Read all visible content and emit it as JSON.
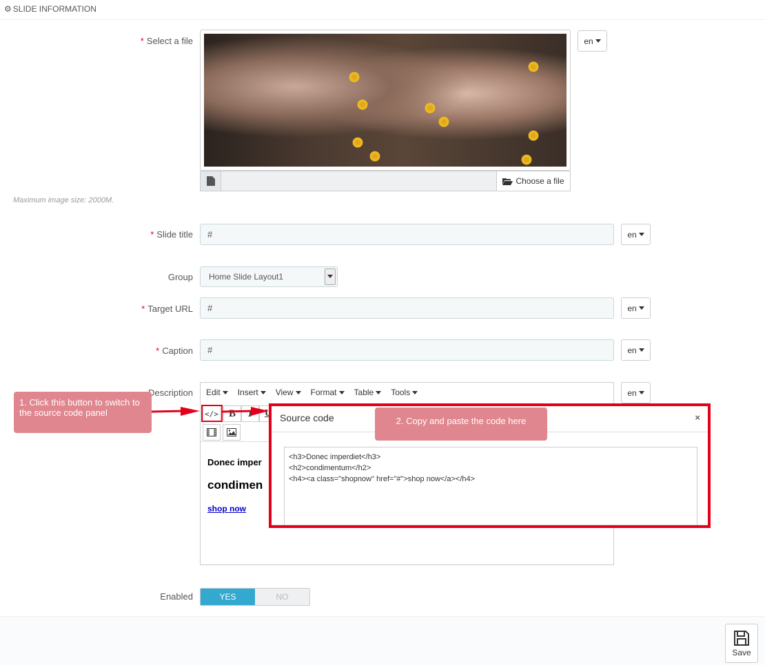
{
  "panel": {
    "title": "SLIDE INFORMATION",
    "icon": "gears-icon"
  },
  "fields": {
    "file": {
      "label": "Select a file",
      "lang": "en",
      "choose_label": "Choose a file",
      "help": "Maximum image size: 2000M."
    },
    "title": {
      "label": "Slide title",
      "value": "#",
      "lang": "en"
    },
    "group": {
      "label": "Group",
      "value": "Home Slide Layout1"
    },
    "url": {
      "label": "Target URL",
      "value": "#",
      "lang": "en"
    },
    "caption": {
      "label": "Caption",
      "value": "#",
      "lang": "en"
    },
    "description": {
      "label": "Description",
      "lang": "en"
    },
    "enabled": {
      "label": "Enabled",
      "yes": "YES",
      "no": "NO"
    }
  },
  "editor": {
    "menu": [
      "Edit",
      "Insert",
      "View",
      "Format",
      "Table",
      "Tools"
    ],
    "content": {
      "h3": "Donec imper",
      "h2": "condimen",
      "link": "shop now"
    }
  },
  "modal": {
    "title": "Source code",
    "close": "×",
    "code": "<h3>Donec imperdiet</h3>\n<h2>condimentum</h2>\n<h4><a class=\"shopnow\" href=\"#\">shop now</a></h4>"
  },
  "callouts": {
    "one": "1. Click this button to switch to the source code panel",
    "two": "2. Copy and paste the code here"
  },
  "footer": {
    "save_label": "Save"
  },
  "colors": {
    "required": "#e3001b",
    "toggle_on": "#34a9d0",
    "callout": "#e0868e",
    "annotation": "#e3001b"
  }
}
